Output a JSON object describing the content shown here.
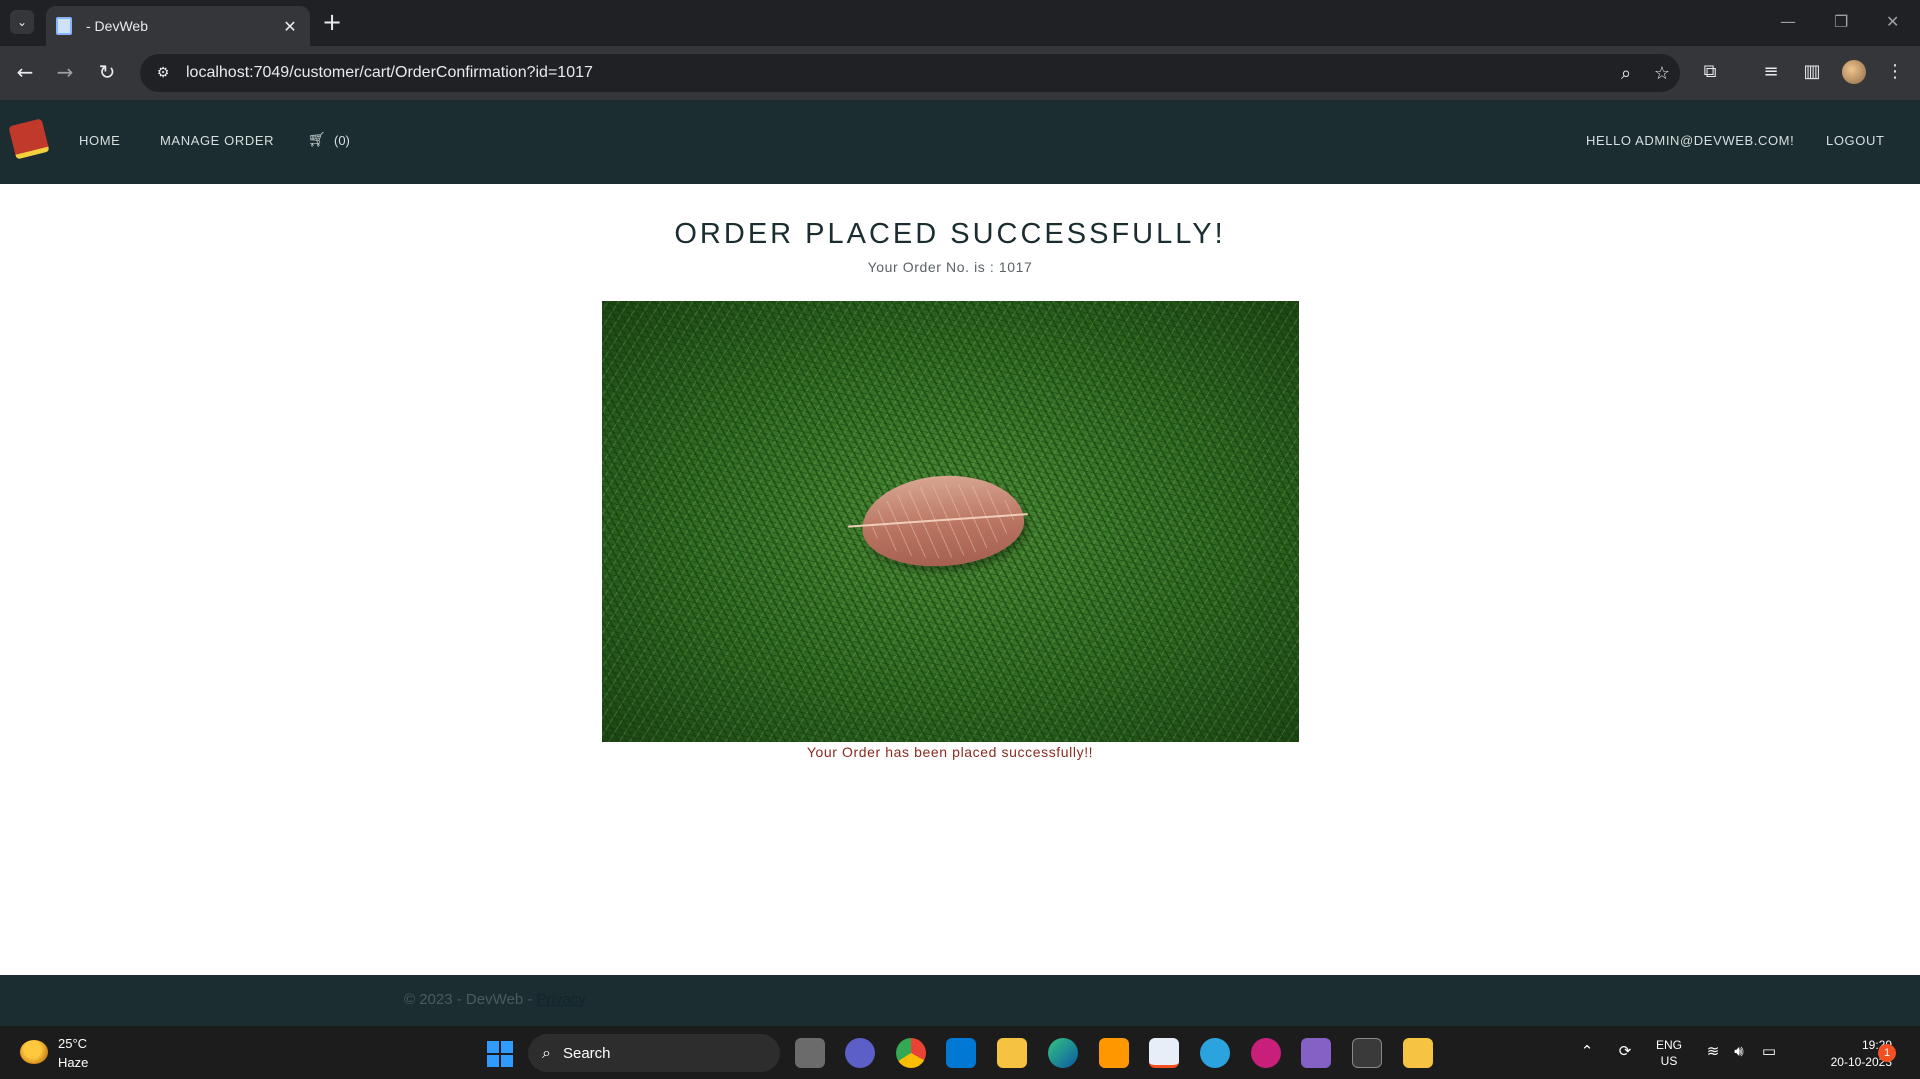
{
  "browser": {
    "tab_title": "- DevWeb",
    "url": "localhost:7049/customer/cart/OrderConfirmation?id=1017",
    "icons": [
      "tab-list-icon",
      "tab-close-icon",
      "new-tab-icon",
      "minimize-icon",
      "restore-icon",
      "window-close-icon",
      "back-icon",
      "forward-icon",
      "reload-icon",
      "site-info-icon",
      "zoom-icon",
      "bookmark-star-icon",
      "extensions-icon",
      "media-control-icon",
      "side-panel-icon",
      "profile-avatar",
      "more-menu-icon"
    ]
  },
  "nav": {
    "home": "HOME",
    "manage_order": "MANAGE ORDER",
    "cart_count": "(0)",
    "greeting": "HELLO ADMIN@DEVWEB.COM!",
    "logout": "LOGOUT"
  },
  "main": {
    "title": "ORDER PLACED SUCCESSFULLY!",
    "order_label": "Your Order No. is : 1017",
    "success_message": "Your Order has been placed successfully!!",
    "image": "leaf on grass"
  },
  "footer": {
    "copyright": "© 2023 - DevWeb - ",
    "privacy": "Privacy"
  },
  "taskbar": {
    "weather_temp": "25°C",
    "weather_condition": "Haze",
    "search_label": "Search",
    "lang_top": "ENG",
    "lang_bottom": "US",
    "time": "19:29",
    "date": "20-10-2023",
    "notification_count": "1",
    "pinned_apps": [
      "task-view",
      "teams-chat",
      "chrome",
      "vs-code",
      "file-explorer",
      "edge",
      "sublime-text",
      "snipping-tool",
      "telegram",
      "vivaldi",
      "visual-studio",
      "terminal",
      "app-installer"
    ],
    "accent_color": "#2f9bff"
  },
  "colors": {
    "nav_bg": "#1b2d30",
    "title_color": "#1b2d30",
    "success_color": "#8b2a1f"
  }
}
